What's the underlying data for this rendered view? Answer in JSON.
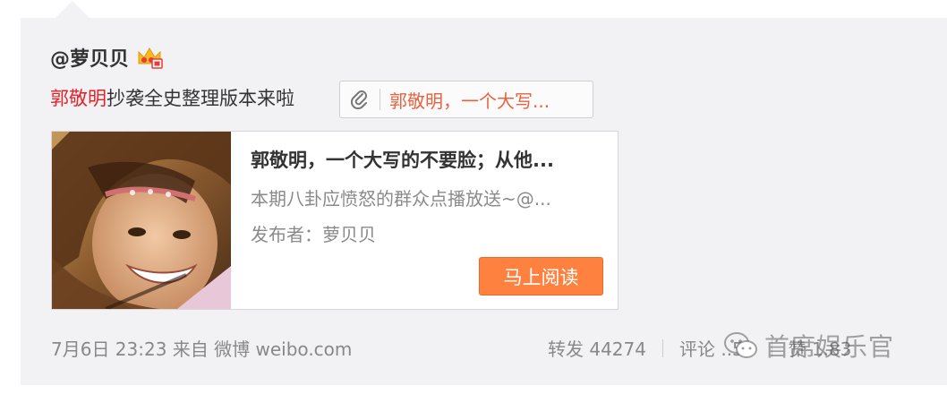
{
  "post": {
    "author": "@萝贝贝",
    "mention": "郭敬明",
    "text": "抄袭全史整理版本来啦",
    "link_title": "郭敬明，一个大写..."
  },
  "card": {
    "title": "郭敬明，一个大写的不要脸；从他...",
    "description": "本期八卦应愤怒的群众点播放送~@...",
    "publisher": "发布者：萝贝贝",
    "read_button": "马上阅读"
  },
  "footer": {
    "timestamp_source": "7月6日 23:23 来自 微博 weibo.com",
    "repost": "转发 44274",
    "comment": "评论 ..53",
    "like": "赞 1.83"
  },
  "watermark": "首席娱乐官",
  "colors": {
    "accent_red": "#e0242a",
    "link_orange": "#e8623f",
    "button_orange": "#ff8140",
    "panel_bg": "#f2f2f5"
  },
  "icons": [
    "crown-badge-icon",
    "paperclip-icon",
    "wechat-icon"
  ]
}
